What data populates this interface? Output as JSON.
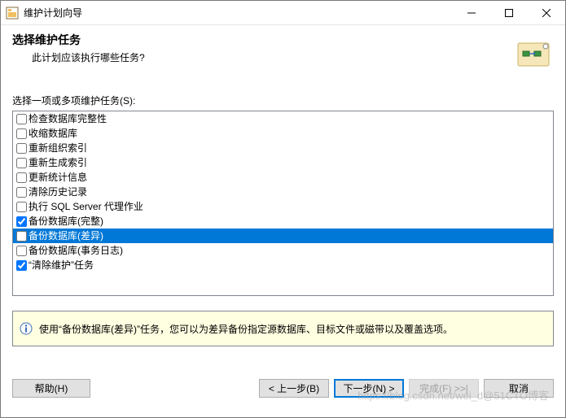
{
  "window": {
    "title": "维护计划向导"
  },
  "header": {
    "title": "选择维护任务",
    "subtitle": "此计划应该执行哪些任务?"
  },
  "list": {
    "label": "选择一项或多项维护任务(S):",
    "items": [
      {
        "label": "检查数据库完整性",
        "checked": false,
        "selected": false
      },
      {
        "label": "收缩数据库",
        "checked": false,
        "selected": false
      },
      {
        "label": "重新组织索引",
        "checked": false,
        "selected": false
      },
      {
        "label": "重新生成索引",
        "checked": false,
        "selected": false
      },
      {
        "label": "更新统计信息",
        "checked": false,
        "selected": false
      },
      {
        "label": "清除历史记录",
        "checked": false,
        "selected": false
      },
      {
        "label": "执行 SQL Server 代理作业",
        "checked": false,
        "selected": false
      },
      {
        "label": "备份数据库(完整)",
        "checked": true,
        "selected": false
      },
      {
        "label": "备份数据库(差异)",
        "checked": false,
        "selected": true
      },
      {
        "label": "备份数据库(事务日志)",
        "checked": false,
        "selected": false
      },
      {
        "label": "“清除维护”任务",
        "checked": true,
        "selected": false
      }
    ]
  },
  "description": {
    "text": "使用“备份数据库(差异)”任务，您可以为差异备份指定源数据库、目标文件或磁带以及覆盖选项。"
  },
  "buttons": {
    "help": "帮助(H)",
    "back": "< 上一步(B)",
    "next": "下一步(N) >",
    "finish": "完成(F) >>|",
    "cancel": "取消"
  },
  "watermark": "https://blog.csdn.net/wei_d@51CTO博客"
}
